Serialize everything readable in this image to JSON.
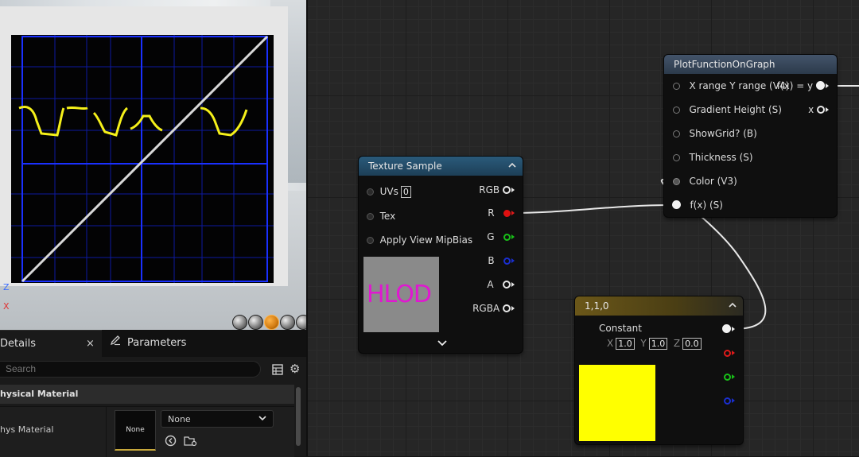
{
  "viewport": {
    "axes": {
      "z": "Z",
      "x": "X"
    }
  },
  "details": {
    "tabs": [
      {
        "label": "Details",
        "close": "×"
      },
      {
        "label": "Parameters"
      }
    ],
    "search": {
      "placeholder": "Search"
    },
    "section": "hysical Material",
    "property": {
      "label": "hys Material",
      "thumbnail": "None",
      "value": "None"
    }
  },
  "nodes": {
    "texture_sample": {
      "title": "Texture Sample",
      "inputs": [
        "UVs",
        "Tex",
        "Apply View MipBias"
      ],
      "uvs_value": "0",
      "outputs": [
        "RGB",
        "R",
        "G",
        "B",
        "A",
        "RGBA"
      ],
      "preview_text": "HLOD"
    },
    "plot_function": {
      "title": "PlotFunctionOnGraph",
      "inputs": [
        "X range Y range (V4)",
        "Gradient Height (S)",
        "ShowGrid? (B)",
        "Thickness (S)",
        "Color (V3)",
        "f(x) (S)"
      ],
      "outputs": [
        "f(x) = y",
        "x"
      ]
    },
    "constant": {
      "title": "1,1,0",
      "label": "Constant",
      "x_label": "X",
      "x_value": "1.0",
      "y_label": "Y",
      "y_value": "1.0",
      "z_label": "Z",
      "z_value": "0.0",
      "color": "#ffff00"
    }
  },
  "colors": {
    "header_blue": "#2a5a7a",
    "header_gray": "#43546a",
    "header_gold": "#6b5719",
    "plot_line": "#f5f01a",
    "grid_line": "#1a30ff"
  }
}
